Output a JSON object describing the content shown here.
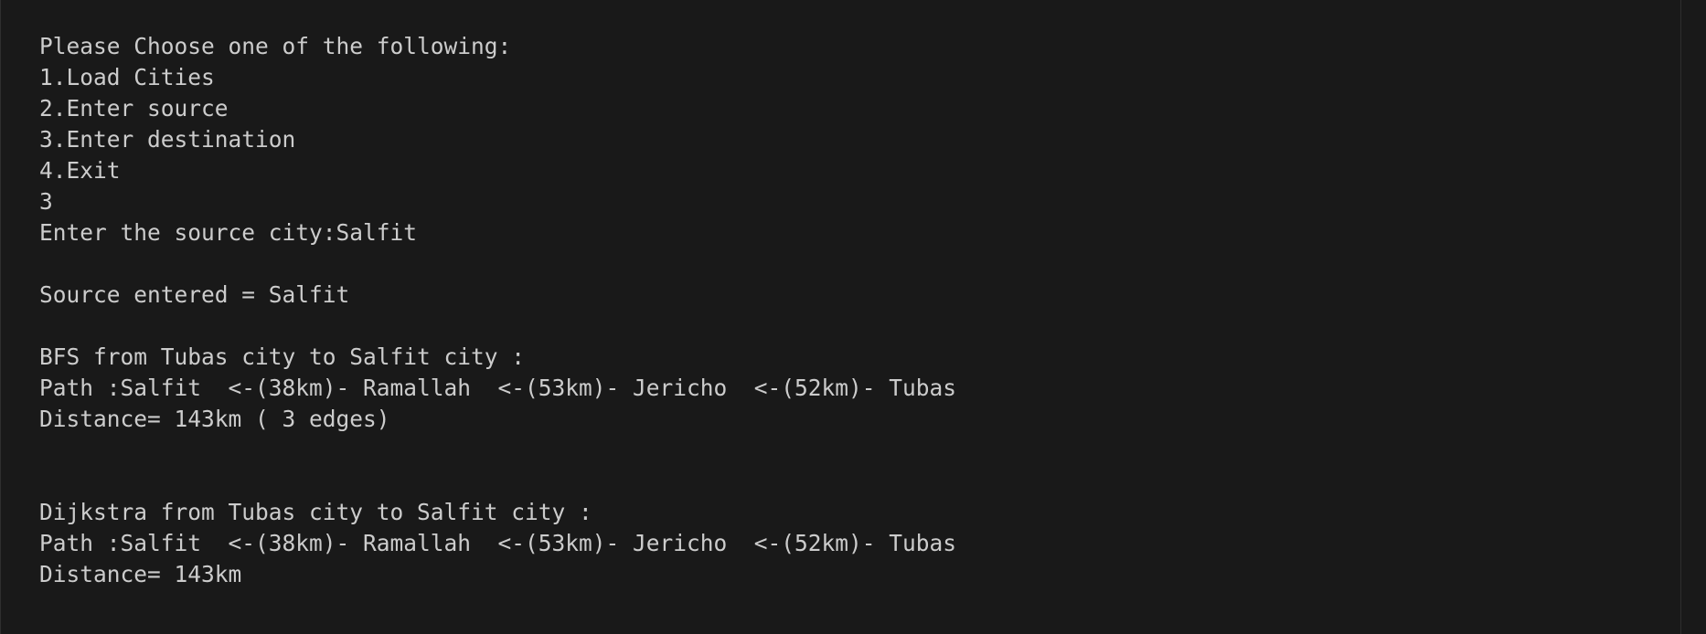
{
  "terminal": {
    "lines": [
      "Please Choose one of the following:",
      "1.Load Cities",
      "2.Enter source",
      "3.Enter destination",
      "4.Exit",
      "3",
      "Enter the source city:Salfit",
      "",
      "Source entered = Salfit",
      "",
      "BFS from Tubas city to Salfit city :",
      "Path :Salfit  <-(38km)- Ramallah  <-(53km)- Jericho  <-(52km)- Tubas",
      "Distance= 143km ( 3 edges)",
      "",
      "",
      "Dijkstra from Tubas city to Salfit city :",
      "Path :Salfit  <-(38km)- Ramallah  <-(53km)- Jericho  <-(52km)- Tubas",
      "Distance= 143km"
    ]
  },
  "colors": {
    "background": "#191919",
    "text": "#cccccc"
  }
}
